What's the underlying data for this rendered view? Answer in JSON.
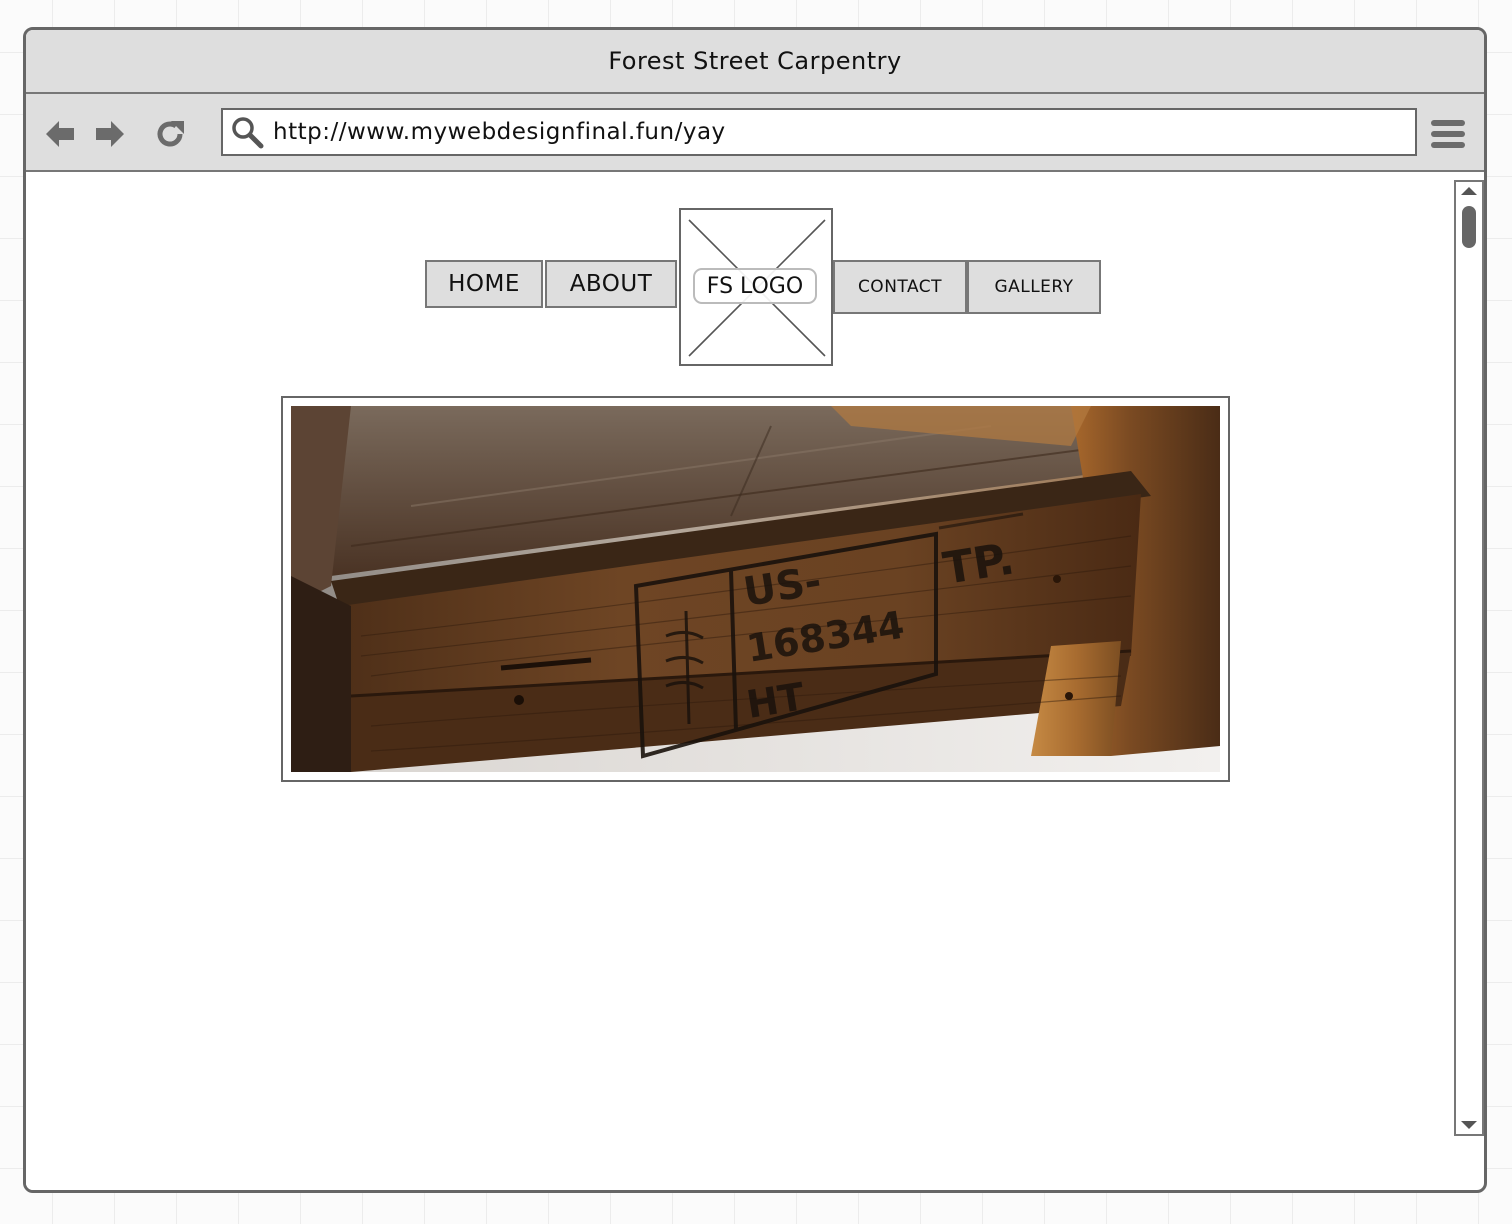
{
  "window": {
    "title": "Forest Street Carpentry"
  },
  "toolbar": {
    "url": "http://www.mywebdesignfinal.fun/yay",
    "icons": [
      "back-arrow-icon",
      "forward-arrow-icon",
      "refresh-icon",
      "search-icon",
      "menu-icon"
    ]
  },
  "nav": {
    "home": "HOME",
    "about": "ABOUT",
    "logo": "FS LOGO",
    "contact": "CONTACT",
    "gallery": "GALLERY"
  },
  "hero": {
    "stamp_line1": "US-",
    "stamp_line2": "168344",
    "stamp_line3": "HT",
    "stamp_mark": "TP."
  },
  "colors": {
    "chrome": "#dedede",
    "border": "#666666",
    "wood_dark": "#3a2414",
    "wood_mid": "#6e4524",
    "wood_light": "#b07a3e"
  }
}
